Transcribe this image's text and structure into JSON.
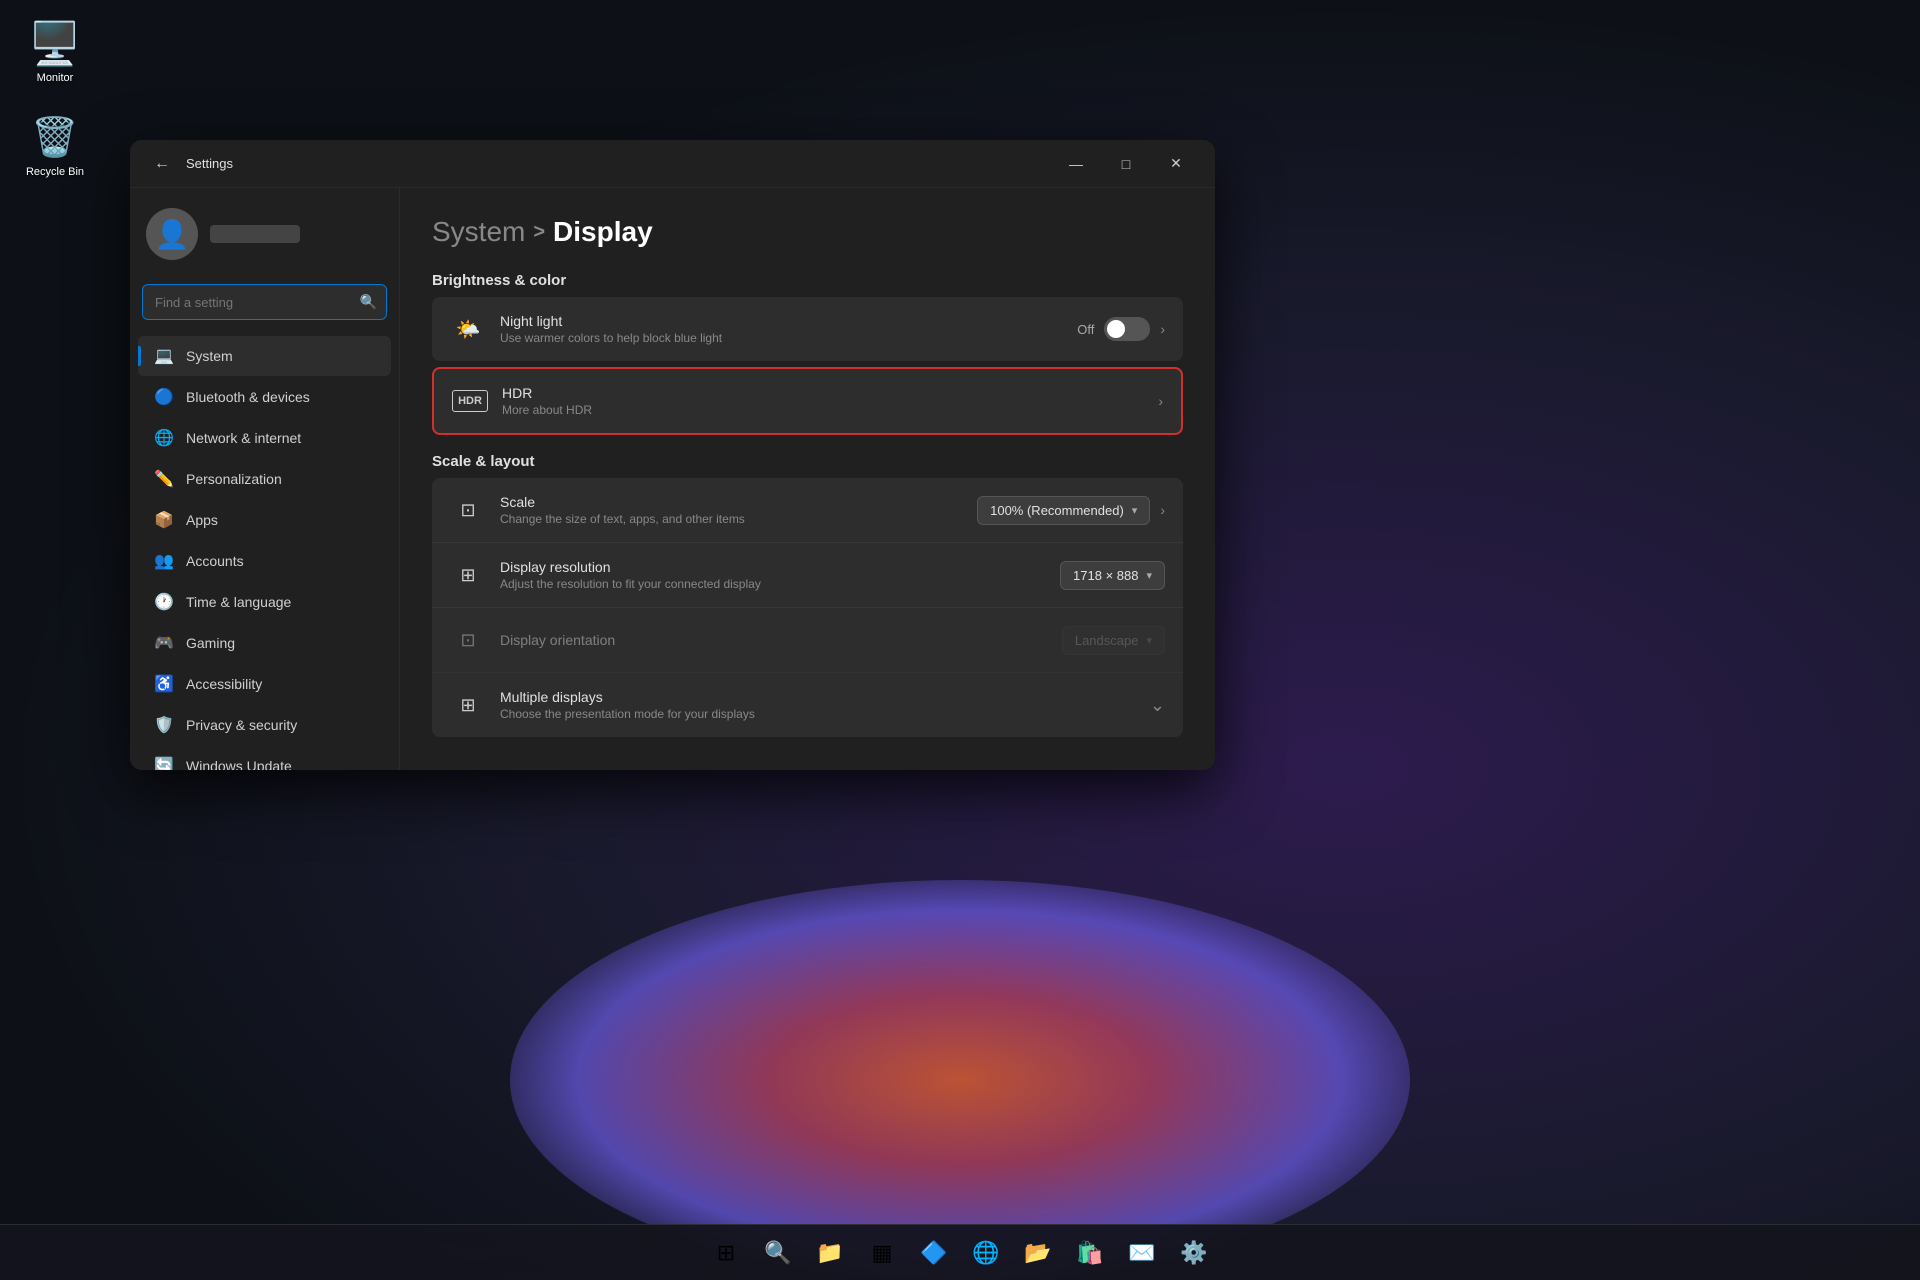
{
  "desktop": {
    "icons": [
      {
        "id": "monitor",
        "label": "Monitor",
        "icon": "🖥️"
      },
      {
        "id": "recycle",
        "label": "Recycle Bin",
        "icon": "🗑️"
      }
    ]
  },
  "taskbar": {
    "items": [
      {
        "id": "start",
        "icon": "⊞",
        "label": "Start"
      },
      {
        "id": "search",
        "icon": "🔍",
        "label": "Search"
      },
      {
        "id": "file-explorer",
        "icon": "📁",
        "label": "File Explorer"
      },
      {
        "id": "widgets",
        "icon": "▦",
        "label": "Widgets"
      },
      {
        "id": "store2",
        "icon": "🔷",
        "label": "App"
      },
      {
        "id": "edge",
        "icon": "🌐",
        "label": "Edge"
      },
      {
        "id": "files",
        "icon": "📂",
        "label": "Files"
      },
      {
        "id": "ms-store",
        "icon": "🛍️",
        "label": "Microsoft Store"
      },
      {
        "id": "mail",
        "icon": "✉️",
        "label": "Mail"
      },
      {
        "id": "settings-tb",
        "icon": "⚙️",
        "label": "Settings"
      }
    ]
  },
  "window": {
    "title": "Settings",
    "back_icon": "←",
    "minimize_icon": "—",
    "maximize_icon": "□",
    "close_icon": "✕"
  },
  "user": {
    "avatar_icon": "👤",
    "name_placeholder": ""
  },
  "search": {
    "placeholder": "Find a setting",
    "icon": "🔍"
  },
  "nav": {
    "items": [
      {
        "id": "system",
        "icon": "💻",
        "label": "System",
        "active": true
      },
      {
        "id": "bluetooth",
        "icon": "🔵",
        "label": "Bluetooth & devices",
        "active": false
      },
      {
        "id": "network",
        "icon": "🌐",
        "label": "Network & internet",
        "active": false
      },
      {
        "id": "personalization",
        "icon": "✏️",
        "label": "Personalization",
        "active": false
      },
      {
        "id": "apps",
        "icon": "📦",
        "label": "Apps",
        "active": false
      },
      {
        "id": "accounts",
        "icon": "👥",
        "label": "Accounts",
        "active": false
      },
      {
        "id": "time",
        "icon": "🕐",
        "label": "Time & language",
        "active": false
      },
      {
        "id": "gaming",
        "icon": "🎮",
        "label": "Gaming",
        "active": false
      },
      {
        "id": "accessibility",
        "icon": "♿",
        "label": "Accessibility",
        "active": false
      },
      {
        "id": "privacy",
        "icon": "🛡️",
        "label": "Privacy & security",
        "active": false
      },
      {
        "id": "windows-update",
        "icon": "🔄",
        "label": "Windows Update",
        "active": false
      }
    ]
  },
  "main": {
    "breadcrumb_parent": "System",
    "breadcrumb_sep": ">",
    "breadcrumb_current": "Display",
    "sections": [
      {
        "id": "brightness-color",
        "title": "Brightness & color",
        "rows": [
          {
            "id": "night-light",
            "icon": "🌤️",
            "title": "Night light",
            "subtitle": "Use warmer colors to help block blue light",
            "control_type": "toggle",
            "toggle_state": "off",
            "toggle_label": "Off",
            "has_chevron": true,
            "highlighted": false,
            "disabled": false
          },
          {
            "id": "hdr",
            "icon": "HDR",
            "title": "HDR",
            "subtitle": "More about HDR",
            "control_type": "chevron",
            "has_chevron": true,
            "highlighted": true,
            "disabled": false
          }
        ]
      },
      {
        "id": "scale-layout",
        "title": "Scale & layout",
        "rows": [
          {
            "id": "scale",
            "icon": "⊡",
            "title": "Scale",
            "subtitle": "Change the size of text, apps, and other items",
            "control_type": "dropdown",
            "dropdown_value": "100% (Recommended)",
            "has_chevron": true,
            "highlighted": false,
            "disabled": false
          },
          {
            "id": "display-resolution",
            "icon": "⊞",
            "title": "Display resolution",
            "subtitle": "Adjust the resolution to fit your connected display",
            "control_type": "dropdown",
            "dropdown_value": "1718 × 888",
            "has_chevron": false,
            "highlighted": false,
            "disabled": false
          },
          {
            "id": "display-orientation",
            "icon": "⊡",
            "title": "Display orientation",
            "subtitle": "",
            "control_type": "dropdown",
            "dropdown_value": "Landscape",
            "has_chevron": false,
            "highlighted": false,
            "disabled": true
          },
          {
            "id": "multiple-displays",
            "icon": "⊞",
            "title": "Multiple displays",
            "subtitle": "Choose the presentation mode for your displays",
            "control_type": "expand",
            "has_chevron": true,
            "highlighted": false,
            "disabled": false
          }
        ]
      }
    ]
  }
}
